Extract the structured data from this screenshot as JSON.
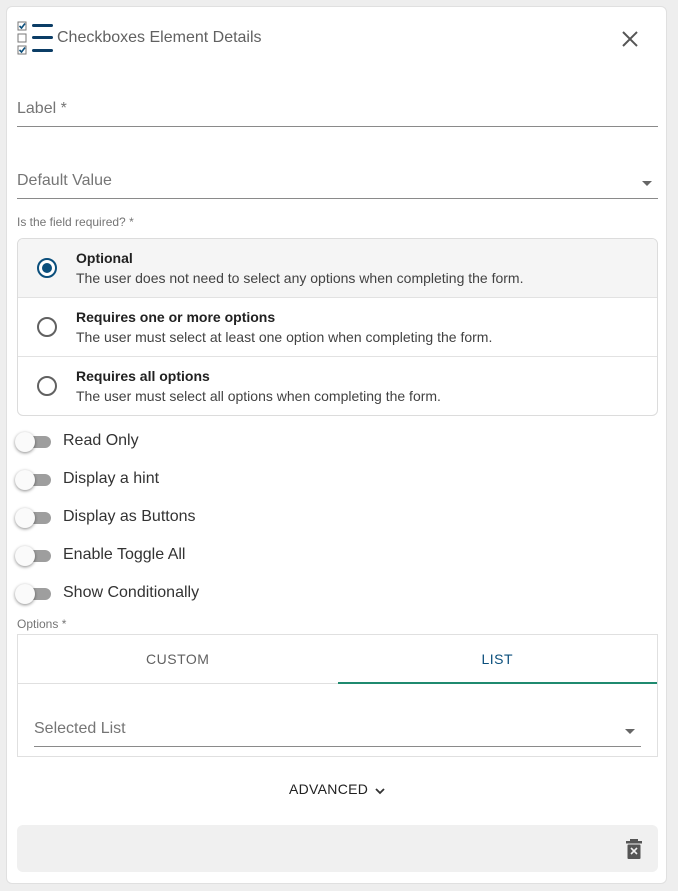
{
  "header": {
    "title": "Checkboxes Element Details",
    "icon": "checkboxes-list-icon",
    "close_icon": "close-icon"
  },
  "fields": {
    "label": {
      "label": "Label *",
      "value": ""
    },
    "default_value": {
      "label": "Default Value",
      "value": ""
    }
  },
  "required": {
    "label": "Is the field required? *",
    "selected": 0,
    "options": [
      {
        "title": "Optional",
        "description": "The user does not need to select any options when completing the form."
      },
      {
        "title": "Requires one or more options",
        "description": "The user must select at least one option when completing the form."
      },
      {
        "title": "Requires all options",
        "description": "The user must select all options when completing the form."
      }
    ]
  },
  "toggles": [
    {
      "label": "Read Only",
      "on": false
    },
    {
      "label": "Display a hint",
      "on": false
    },
    {
      "label": "Display as Buttons",
      "on": false
    },
    {
      "label": "Enable Toggle All",
      "on": false
    },
    {
      "label": "Show Conditionally",
      "on": false
    }
  ],
  "options": {
    "label": "Options *",
    "tabs": [
      {
        "label": "CUSTOM"
      },
      {
        "label": "LIST"
      }
    ],
    "active_tab": 1,
    "selected_list": {
      "label": "Selected List",
      "value": ""
    }
  },
  "advanced": {
    "label": "ADVANCED"
  },
  "footer": {
    "delete_icon": "trash-icon"
  },
  "colors": {
    "primary": "#0b4f7c",
    "tab_indicator": "#1f8a6f"
  }
}
